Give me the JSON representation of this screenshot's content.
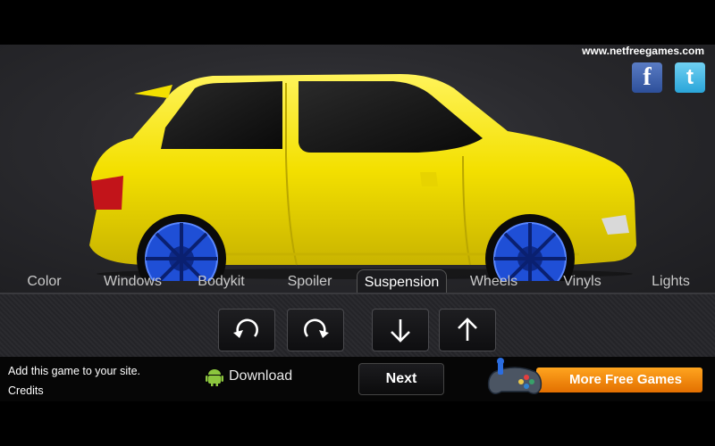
{
  "header": {
    "site": "www.netfreegames.com",
    "social": [
      {
        "name": "facebook",
        "glyph": "f",
        "color": "#3b5998"
      },
      {
        "name": "twitter",
        "glyph": "t",
        "color": "#29a9e0"
      }
    ]
  },
  "car": {
    "body_color": "#f3e000",
    "wheel_color": "#1f4fd6"
  },
  "tabs": [
    "Color",
    "Windows",
    "Bodykit",
    "Spoiler",
    "Suspension",
    "Wheels",
    "Vinyls",
    "Lights"
  ],
  "active_tab": "Suspension",
  "controls": [
    {
      "name": "rotate-left-icon"
    },
    {
      "name": "rotate-right-icon"
    },
    {
      "name": "arrow-down-icon"
    },
    {
      "name": "arrow-up-icon"
    }
  ],
  "footer": {
    "add_site": "Add this game to your site.",
    "credits": "Credits",
    "download": "Download",
    "next": "Next",
    "more_games": "More Free Games",
    "accent": "#f28a0c"
  }
}
